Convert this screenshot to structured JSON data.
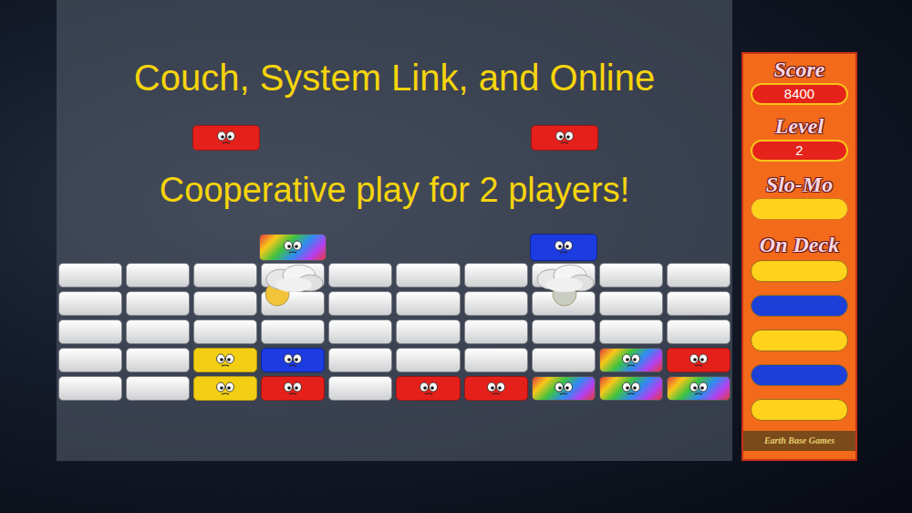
{
  "headline": [
    "Couch, System Link, and Online",
    "Cooperative play for 2 players!"
  ],
  "falling": [
    {
      "kind": "red"
    },
    {
      "kind": "red"
    }
  ],
  "players": [
    {
      "kind": "rainbow",
      "color": "#f2c43a"
    },
    {
      "kind": "blue",
      "color": "#c9cdc2"
    }
  ],
  "grid": [
    [
      "white",
      "white",
      "white",
      "white",
      "white",
      "white",
      "white",
      "white",
      "white",
      "white"
    ],
    [
      "white",
      "white",
      "white",
      "white",
      "white",
      "white",
      "white",
      "white",
      "white",
      "white"
    ],
    [
      "white",
      "white",
      "white",
      "white",
      "white",
      "white",
      "white",
      "white",
      "white",
      "white"
    ],
    [
      "white",
      "white",
      "yellow",
      "blue",
      "white",
      "white",
      "white",
      "white",
      "rainbow",
      "red"
    ],
    [
      "white",
      "white",
      "yellow",
      "red",
      "white",
      "red",
      "red",
      "rainbow",
      "rainbow",
      "rainbow"
    ]
  ],
  "panel": {
    "score": {
      "label": "Score",
      "value": "8400"
    },
    "level": {
      "label": "Level",
      "value": "2"
    },
    "slomo": {
      "label": "Slo-Mo",
      "level": 1
    },
    "on_deck": {
      "label": "On Deck",
      "items": [
        {
          "color": "#ffd21c"
        },
        {
          "color": "#1c3fd8"
        },
        {
          "color": "#ffd21c"
        },
        {
          "color": "#1c3fd8"
        },
        {
          "color": "#ffd21c"
        }
      ]
    },
    "brand": "Earth Base Games"
  }
}
